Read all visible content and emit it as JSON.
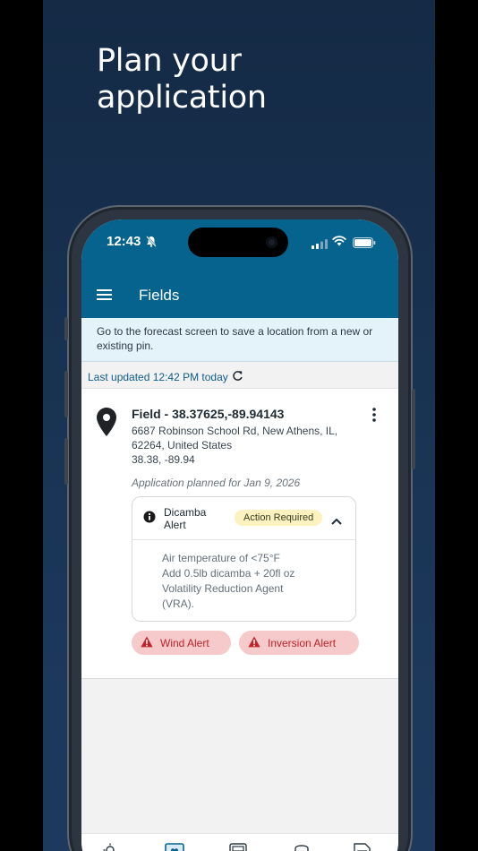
{
  "promo": {
    "headline": "Plan your application"
  },
  "status_bar": {
    "time": "12:43"
  },
  "app_bar": {
    "title": "Fields"
  },
  "banner": {
    "text": "Go to the forecast screen to save a location from a new or existing pin."
  },
  "last_updated": {
    "text": "Last updated 12:42 PM today"
  },
  "field_card": {
    "name": "Field - 38.37625,-89.94143",
    "address": "6687 Robinson School Rd, New Athens, IL, 62264, United States",
    "coords": "38.38, -89.94",
    "planned": "Application planned for Jan 9, 2026",
    "dicamba_alert": {
      "title": "Dicamba Alert",
      "badge": "Action Required",
      "lines": [
        "Air temperature of <75°F",
        "Add 0.5lb dicamba + 20fl oz",
        "Volatility Reduction Agent",
        "(VRA)."
      ]
    },
    "wind_alert": "Wind Alert",
    "inversion_alert": "Inversion Alert"
  },
  "bottom_nav": [
    "weather-icon",
    "fields-icon",
    "calculator-icon",
    "sprayer-icon",
    "records-icon"
  ],
  "colors": {
    "brand": "#06638d",
    "banner_bg": "#e4f3fa",
    "alert_pill_bg": "#f6c9cb",
    "alert_pill_text": "#c0242a",
    "badge_bg": "#fbf2bf"
  }
}
